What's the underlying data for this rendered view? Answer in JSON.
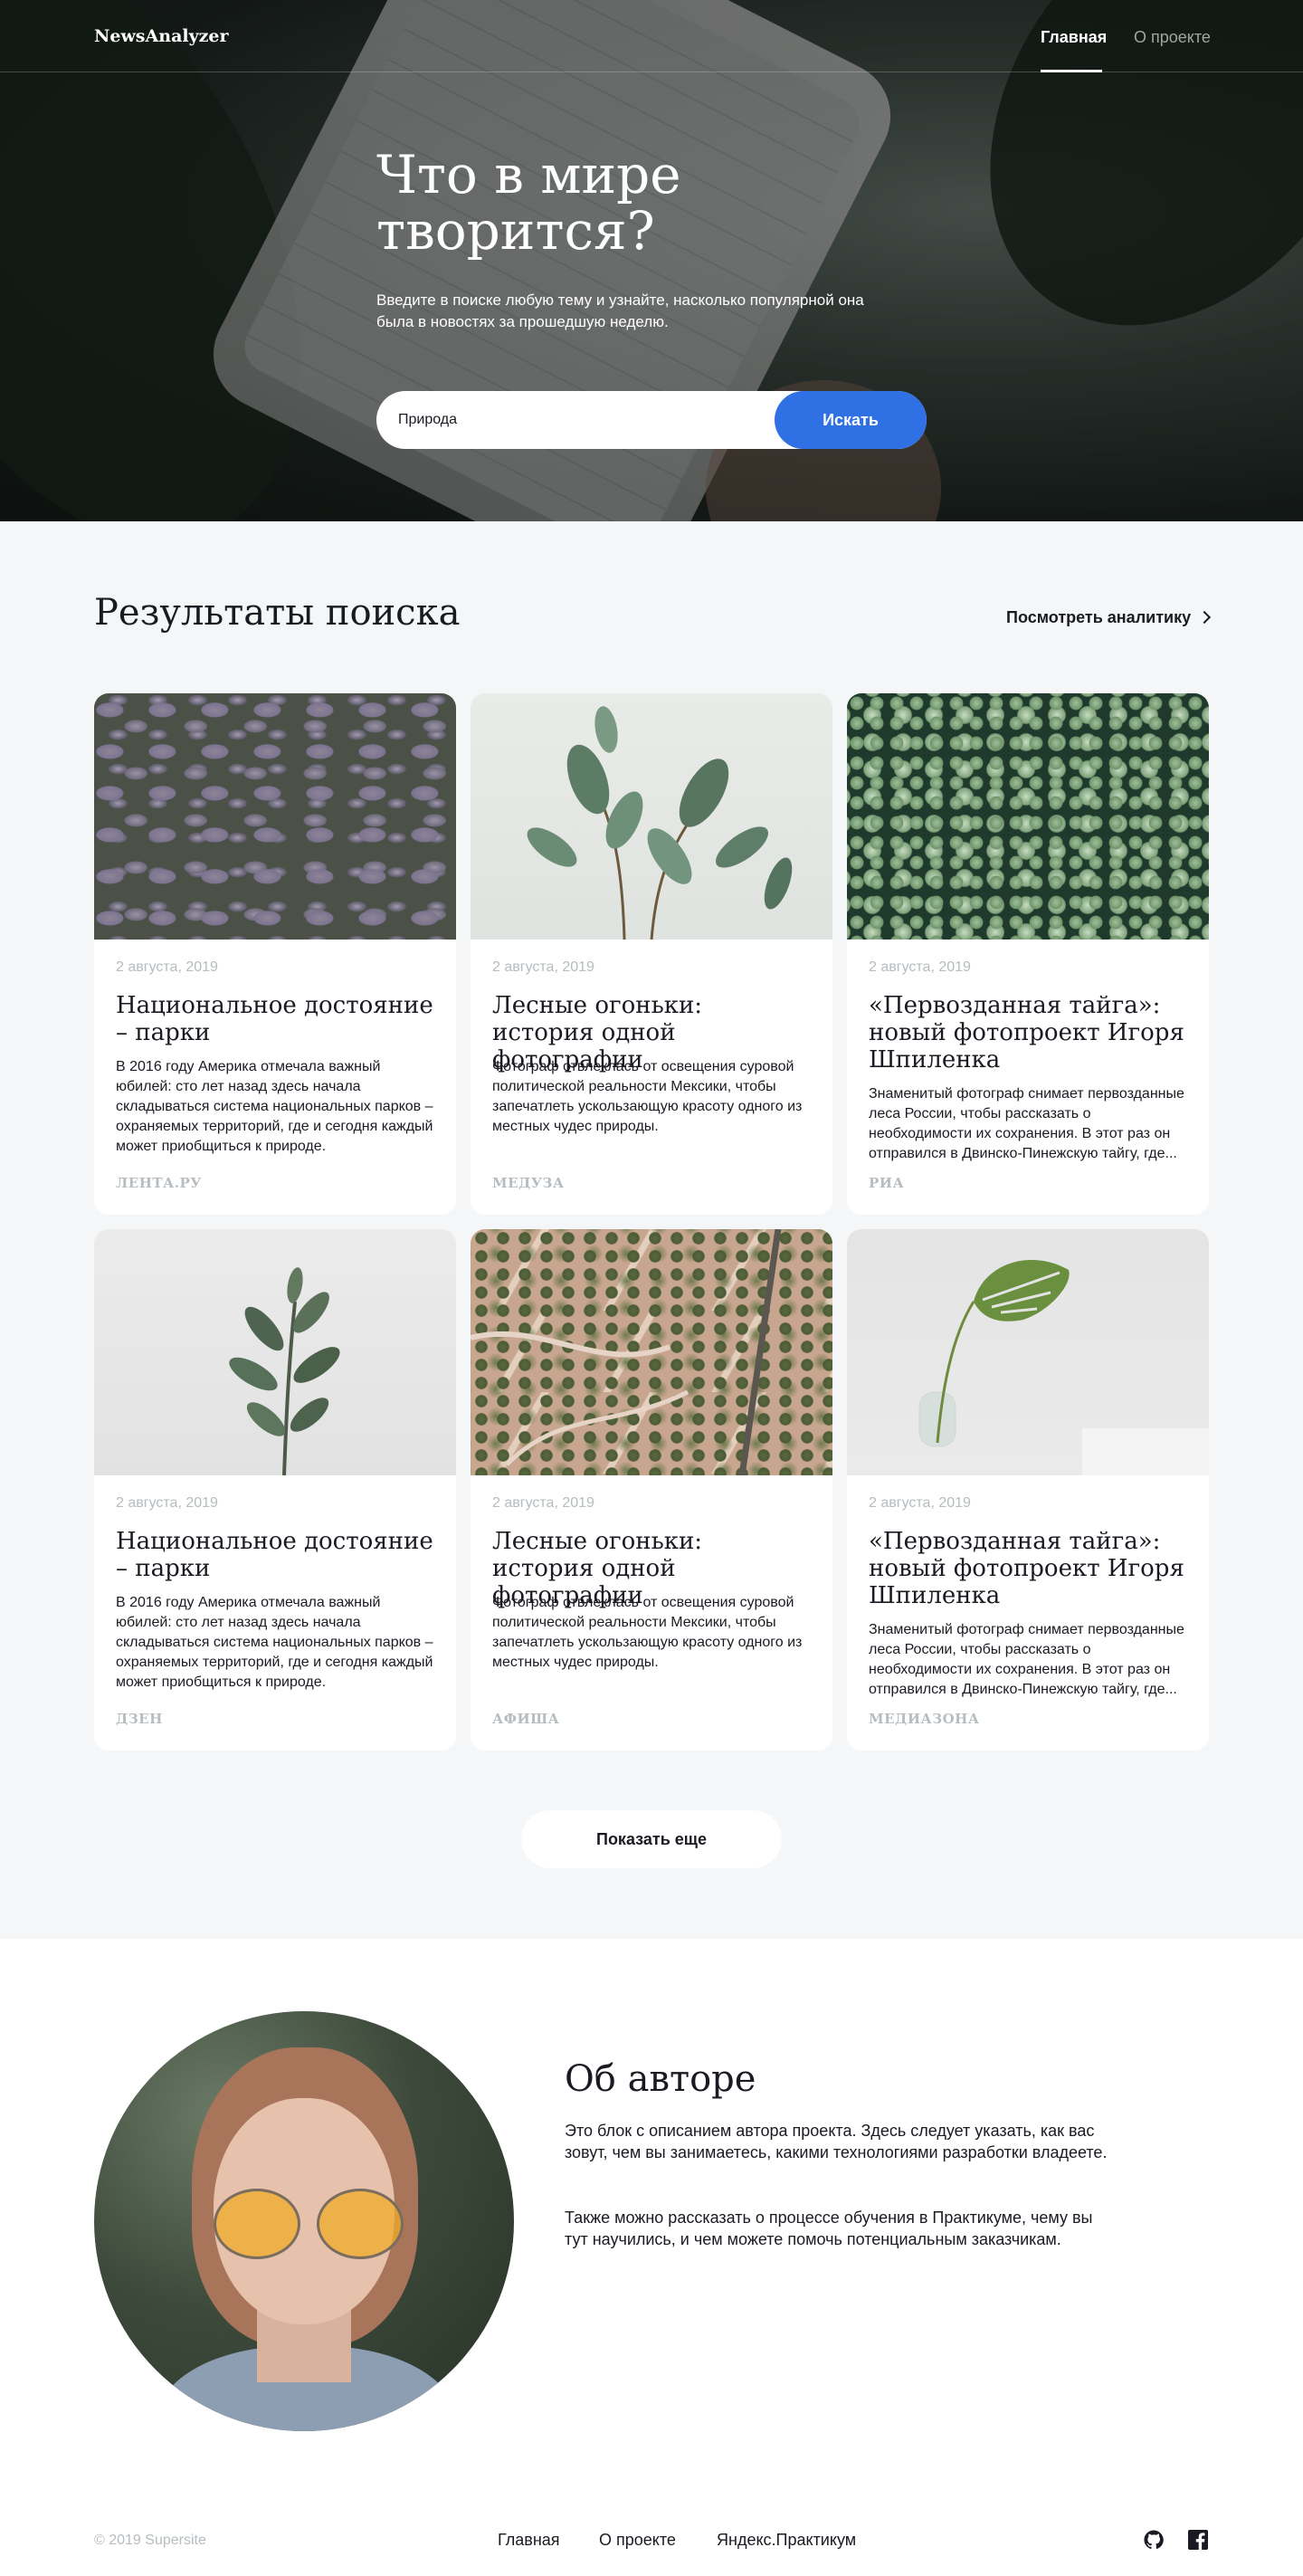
{
  "header": {
    "logo": "NewsAnalyzer",
    "nav": [
      {
        "label": "Главная",
        "active": true
      },
      {
        "label": "О проекте",
        "active": false
      }
    ]
  },
  "hero": {
    "title": "Что в мире творится?",
    "subtitle": "Введите в поиске любую тему и узнайте, насколько популярной она была в новостях за прошедшую неделю.",
    "search_value": "Природа",
    "search_button": "Искать"
  },
  "results": {
    "title": "Результаты поиска",
    "analytics_link": "Посмотреть аналитику",
    "cards": [
      {
        "date": "2 августа, 2019",
        "title": "Национальное достояние – парки",
        "text": "В 2016 году Америка отмечала важный юбилей: сто лет назад здесь начала складываться система национальных парков – охраняемых территорий, где и сегодня каждый может приобщиться к природе.",
        "source": "ЛЕНТА.РУ",
        "image": "purple-leaves"
      },
      {
        "date": "2 августа, 2019",
        "title": "Лесные огоньки: история одной фотографии",
        "text": "Фотограф отвлеклась от освещения суровой политической реальности Мексики, чтобы запечатлеть ускользающую красоту одного из местных чудес природы.",
        "source": "МЕДУЗА",
        "image": "ficus-plant"
      },
      {
        "date": "2 августа, 2019",
        "title": "«Первозданная тайга»: новый фотопроект Игоря Шпиленка",
        "text": "Знаменитый фотограф снимает первозданные леса России, чтобы рассказать о необходимости их сохранения. В этот раз он отправился в Двинско-Пинежскую тайгу, где...",
        "source": "РИА",
        "image": "round-leaves"
      },
      {
        "date": "2 августа, 2019",
        "title": "Национальное достояние – парки",
        "text": "В 2016 году Америка отмечала важный юбилей: сто лет назад здесь начала складываться система национальных парков – охраняемых территорий, где и сегодня каждый может приобщиться к природе.",
        "source": "ДЗЕН",
        "image": "branch"
      },
      {
        "date": "2 августа, 2019",
        "title": "Лесные огоньки: история одной фотографии",
        "text": "Фотограф отвлеклась от освещения суровой политической реальности Мексики, чтобы запечатлеть ускользающую красоту одного из местных чудес природы.",
        "source": "АФИША",
        "image": "aerial-landscape"
      },
      {
        "date": "2 августа, 2019",
        "title": "«Первозданная тайга»: новый фотопроект Игоря Шпиленка",
        "text": "Знаменитый фотограф снимает первозданные леса России, чтобы рассказать о необходимости их сохранения. В этот раз он отправился в Двинско-Пинежскую тайгу, где...",
        "source": "МЕДИАЗОНА",
        "image": "monstera-vase"
      }
    ],
    "more_button": "Показать еще"
  },
  "about": {
    "title": "Об авторе",
    "p1": "Это блок с описанием автора проекта. Здесь следует указать, как вас зовут, чем вы занимаетесь, какими технологиями разработки владеете.",
    "p2": "Также можно рассказать о процессе обучения в Практикуме, чему вы тут научились, и чем можете помочь потенциальным заказчикам."
  },
  "footer": {
    "copyright": "© 2019 Supersite",
    "links": [
      "Главная",
      "О проекте",
      "Яндекс.Практикум"
    ],
    "icons": [
      "github-icon",
      "facebook-icon"
    ]
  },
  "colors": {
    "accent": "#2f71e5",
    "text": "#1a1b22",
    "muted": "#b6bcbf",
    "section_bg": "#f5f6f7"
  }
}
